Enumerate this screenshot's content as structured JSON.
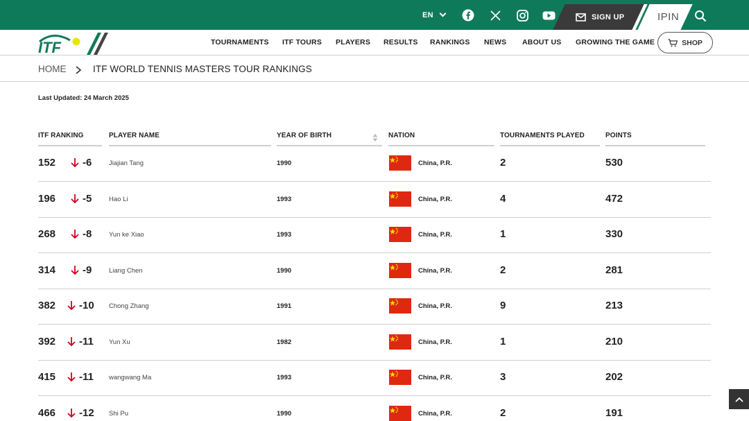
{
  "header": {
    "language": "EN",
    "signup_label": "SIGN UP",
    "ipin_label": "IPIN",
    "social": [
      "facebook-icon",
      "x-icon",
      "instagram-icon",
      "youtube-icon"
    ]
  },
  "nav": {
    "items": [
      "TOURNAMENTS",
      "ITF TOURS",
      "PLAYERS",
      "RESULTS",
      "RANKINGS",
      "NEWS",
      "ABOUT US",
      "GROWING THE GAME"
    ],
    "shop_label": "SHOP"
  },
  "breadcrumb": {
    "home": "HOME",
    "current": "ITF WORLD TENNIS MASTERS TOUR RANKINGS"
  },
  "last_updated": "Last Updated: 24 March 2025",
  "table": {
    "columns": [
      "ITF RANKING",
      "PLAYER NAME",
      "YEAR OF BIRTH",
      "NATION",
      "TOURNAMENTS PLAYED",
      "POINTS"
    ],
    "rows": [
      {
        "rank": "152",
        "movement": "-6",
        "player": "Jiajian  Tang",
        "yob": "1990",
        "nation": "China, P.R.",
        "played": "2",
        "points": "530"
      },
      {
        "rank": "196",
        "movement": "-5",
        "player": "Hao  Li",
        "yob": "1993",
        "nation": "China, P.R.",
        "played": "4",
        "points": "472"
      },
      {
        "rank": "268",
        "movement": "-8",
        "player": "Yun ke  Xiao",
        "yob": "1993",
        "nation": "China, P.R.",
        "played": "1",
        "points": "330"
      },
      {
        "rank": "314",
        "movement": "-9",
        "player": "Liang  Chen",
        "yob": "1990",
        "nation": "China, P.R.",
        "played": "2",
        "points": "281"
      },
      {
        "rank": "382",
        "movement": "-10",
        "player": "Chong  Zhang",
        "yob": "1991",
        "nation": "China, P.R.",
        "played": "9",
        "points": "213"
      },
      {
        "rank": "392",
        "movement": "-11",
        "player": "Yun  Xu",
        "yob": "1982",
        "nation": "China, P.R.",
        "played": "1",
        "points": "210"
      },
      {
        "rank": "415",
        "movement": "-11",
        "player": "wangwang  Ma",
        "yob": "1993",
        "nation": "China, P.R.",
        "played": "3",
        "points": "202"
      },
      {
        "rank": "466",
        "movement": "-12",
        "player": "Shi  Pu",
        "yob": "1990",
        "nation": "China, P.R.",
        "played": "2",
        "points": "191"
      }
    ]
  },
  "colors": {
    "brand_green": "#0f7a5a",
    "down_arrow": "#d0021b",
    "flag_red": "#de2910",
    "flag_yellow": "#ffde00"
  }
}
